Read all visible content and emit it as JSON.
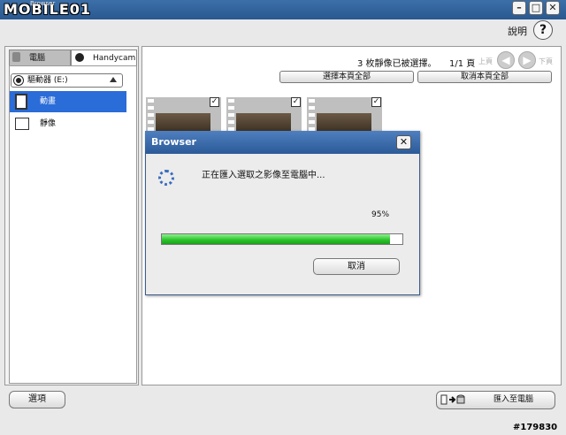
{
  "window": {
    "logo": "MOBILE01",
    "logo_sub": "Browser",
    "min_glyph": "–",
    "max_glyph": "□",
    "close_glyph": "✕"
  },
  "header": {
    "help_label": "說明",
    "help_glyph": "?"
  },
  "sidebar": {
    "tabs": [
      {
        "label": "電腦",
        "active": false
      },
      {
        "label": "Handycam",
        "active": true
      }
    ],
    "drive_label": "驅動器 (E:)",
    "items": [
      {
        "label": "動畫",
        "selected": true
      },
      {
        "label": "靜像",
        "selected": false
      }
    ]
  },
  "main": {
    "selected_count": "3 枚靜像已被選擇。",
    "page_indicator": "1/1 頁",
    "prev_label": "上頁",
    "next_label": "下頁",
    "select_all_label": "選擇本頁全部",
    "deselect_all_label": "取消本頁全部",
    "thumbnails": [
      {
        "checked": true
      },
      {
        "checked": true
      },
      {
        "checked": true
      }
    ],
    "check_glyph": "✓"
  },
  "dialog": {
    "title": "Browser",
    "close_glyph": "✕",
    "message": "正在匯入選取之影像至電腦中...",
    "progress_text": "95%",
    "progress": 0.95,
    "cancel_label": "取消"
  },
  "footer": {
    "options_label": "選項",
    "import_label": "匯入至電腦"
  },
  "watermark": "#179830",
  "colors": {
    "accent": "#2a6cd8",
    "progress": "#27c227",
    "titlebar": "#2c5a98"
  }
}
